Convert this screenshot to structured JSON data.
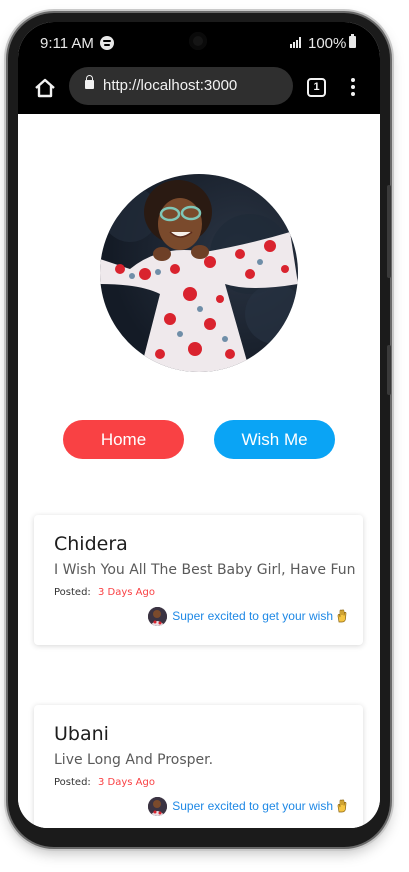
{
  "status_bar": {
    "time": "9:11 AM",
    "battery": "100%"
  },
  "browser": {
    "url": "http://localhost:3000",
    "tab_count": "1"
  },
  "buttons": {
    "home": "Home",
    "wish": "Wish Me"
  },
  "wishes": [
    {
      "name": "Chidera",
      "message": "I Wish You All The Best Baby Girl, Have Fun",
      "posted_label": "Posted:",
      "posted_time": "3 Days Ago",
      "reply": "Super excited to get your wish"
    },
    {
      "name": "Ubani",
      "message": "Live Long And Prosper.",
      "posted_label": "Posted:",
      "posted_time": "3 Days Ago",
      "reply": "Super excited to get your wish"
    }
  ],
  "colors": {
    "home_button": "#f94144",
    "wish_button": "#0aa4f5",
    "posted_time": "#f94144",
    "reply_text": "#1e88e5"
  },
  "icons": {
    "status": [
      "spotify-icon",
      "signal-icon",
      "battery-icon"
    ],
    "browser": [
      "home-icon",
      "lock-icon",
      "tabs-icon",
      "menu-icon"
    ],
    "reply": "raised-hand-icon"
  }
}
